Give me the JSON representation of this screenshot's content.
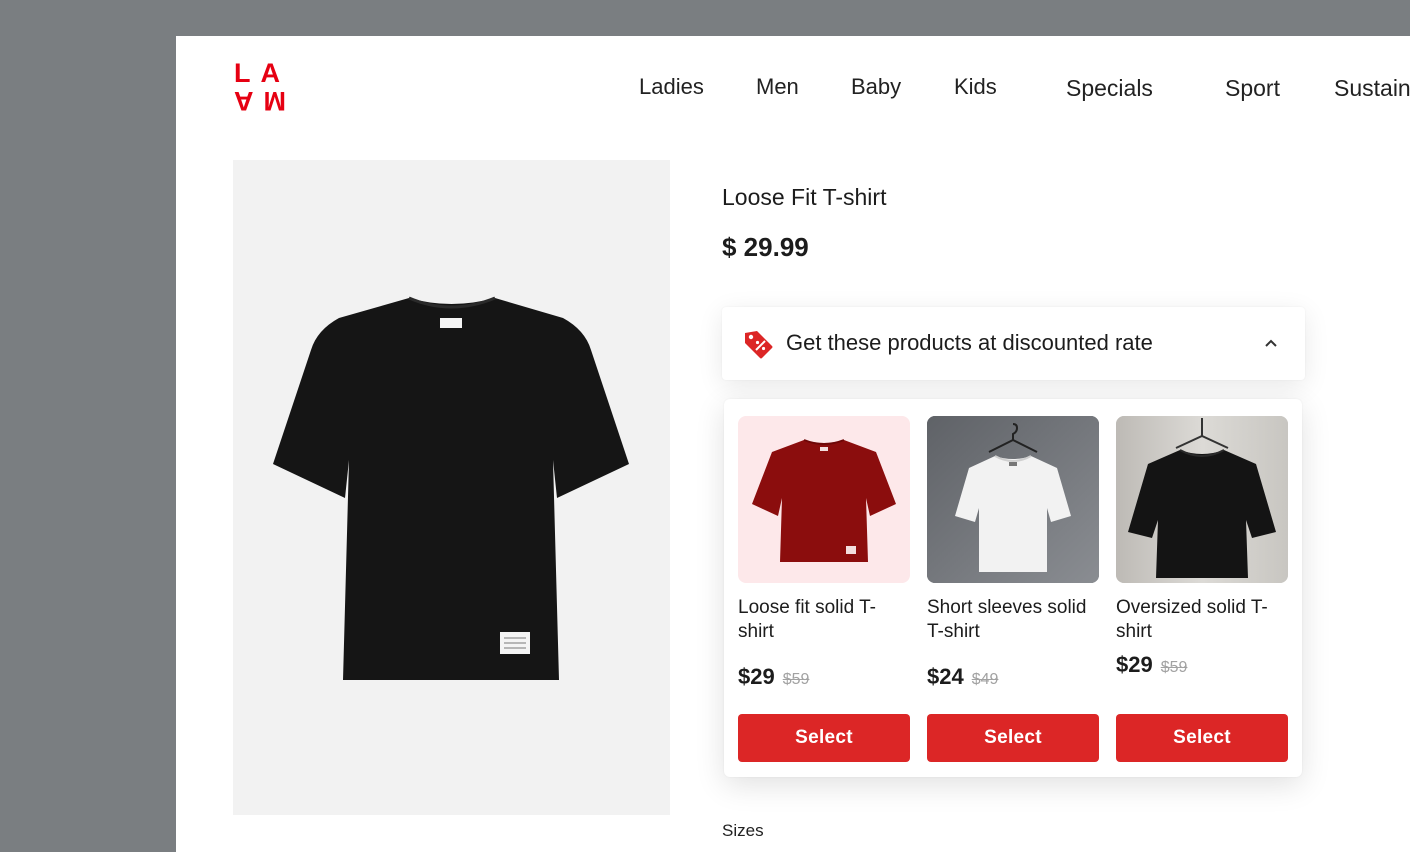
{
  "brand": {
    "logo_top": "LA",
    "logo_bottom": "AM",
    "logo_color": "#e60012"
  },
  "nav": {
    "items": [
      {
        "label": "Ladies"
      },
      {
        "label": "Men"
      },
      {
        "label": "Baby"
      },
      {
        "label": "Kids"
      },
      {
        "label": "Specials"
      },
      {
        "label": "Sport"
      },
      {
        "label": "Sustain"
      }
    ]
  },
  "product": {
    "title": "Loose Fit T-shirt",
    "price": "$ 29.99",
    "image_icon": "black-tshirt-image"
  },
  "discount": {
    "label": "Get these products at discounted rate",
    "icon": "discount-tag-icon",
    "expanded_icon": "chevron-up-icon",
    "accent": "#dc2626"
  },
  "offers": [
    {
      "name": "Loose fit solid T-shirt",
      "price": "$29",
      "old_price": "$59",
      "button": "Select",
      "image": "red-tshirt-image"
    },
    {
      "name": "Short sleeves solid T-shirt",
      "price": "$24",
      "old_price": "$49",
      "button": "Select",
      "image": "white-tshirt-image"
    },
    {
      "name": "Oversized solid T-shirt",
      "price": "$29",
      "old_price": "$59",
      "button": "Select",
      "image": "black-oversized-tshirt-image"
    }
  ],
  "sizes": {
    "label": "Sizes"
  }
}
